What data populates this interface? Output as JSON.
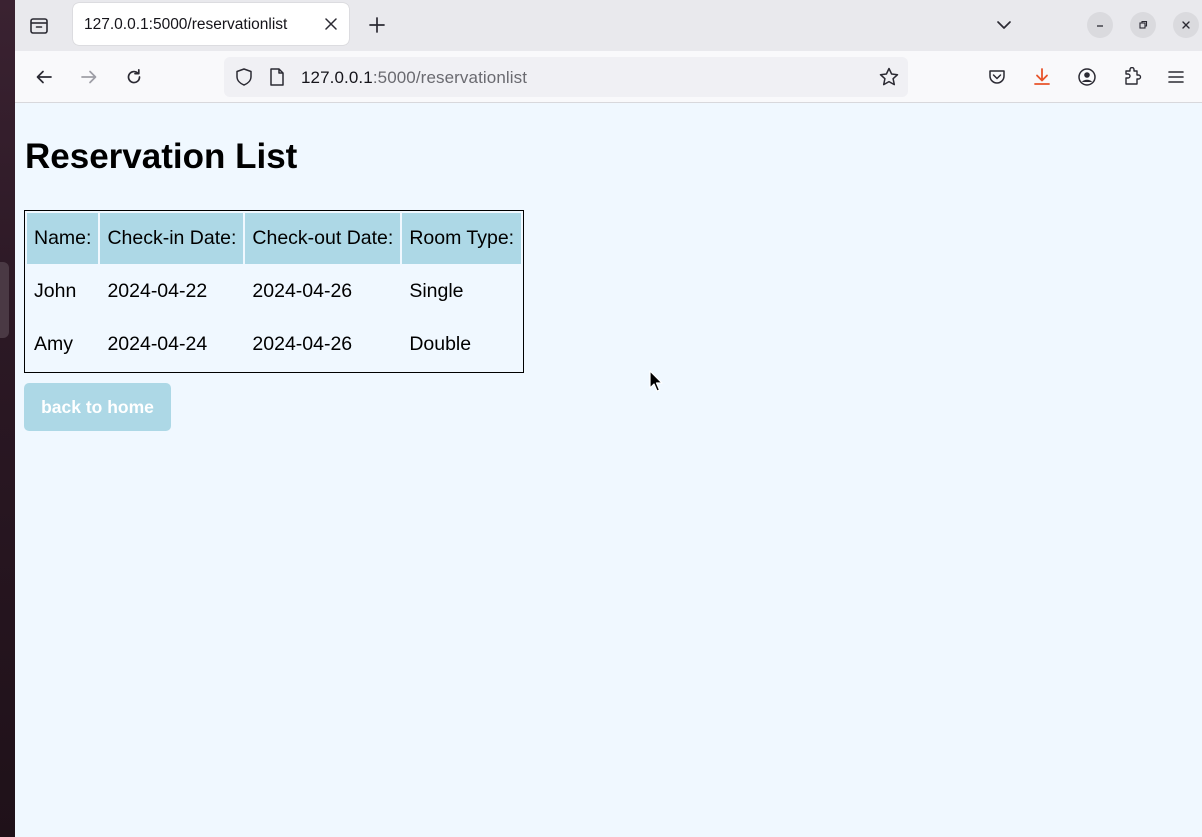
{
  "browser": {
    "tab": {
      "title": "127.0.0.1:5000/reservationlist"
    },
    "url": {
      "host": "127.0.0.1",
      "path": ":5000/reservationlist"
    },
    "icons": [
      "tab-overview-icon",
      "close-icon",
      "plus-icon",
      "chevron-down-icon",
      "minimize-icon",
      "restore-icon",
      "close-window-icon",
      "back-arrow-icon",
      "forward-arrow-icon",
      "reload-icon",
      "shield-icon",
      "page-icon",
      "star-icon",
      "pocket-icon",
      "download-icon",
      "account-icon",
      "extensions-icon",
      "menu-icon"
    ],
    "colors": {
      "download_accent": "#e8542b"
    }
  },
  "page": {
    "title": "Reservation List",
    "table": {
      "headers": [
        "Name:",
        "Check-in Date:",
        "Check-out Date:",
        "Room Type:"
      ],
      "rows": [
        [
          "John",
          "2024-04-22",
          "2024-04-26",
          "Single"
        ],
        [
          "Amy",
          "2024-04-24",
          "2024-04-26",
          "Double"
        ]
      ]
    },
    "back_button": "back to home",
    "colors": {
      "background": "#f0f8ff",
      "header_cell": "#add8e6",
      "button": "#add8e6"
    }
  }
}
